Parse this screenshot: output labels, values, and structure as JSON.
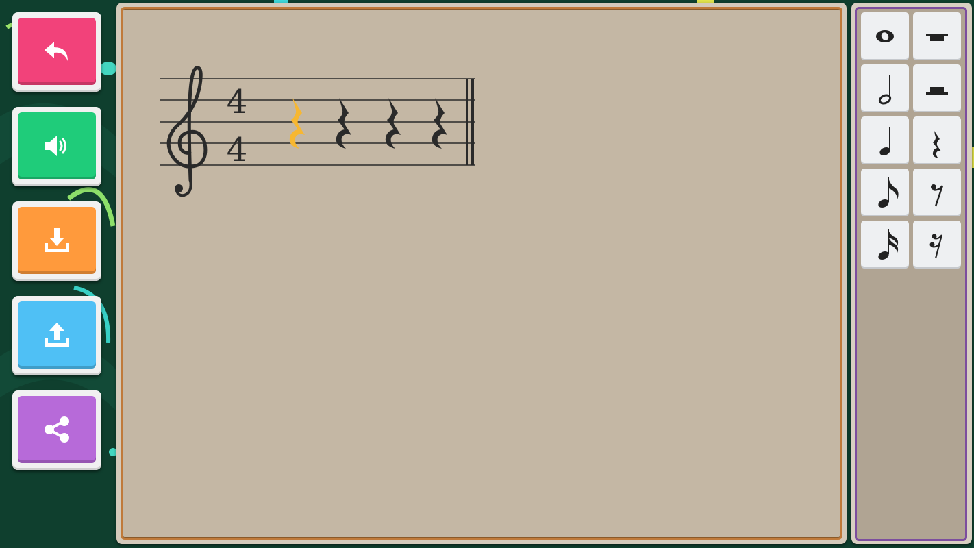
{
  "toolbar": {
    "buttons": [
      {
        "name": "undo-button",
        "icon": "undo-arrow-icon",
        "color": "#f2427a"
      },
      {
        "name": "play-sound-button",
        "icon": "speaker-icon",
        "color": "#1fcc7a"
      },
      {
        "name": "download-button",
        "icon": "download-icon",
        "color": "#ff9a3c"
      },
      {
        "name": "upload-button",
        "icon": "upload-icon",
        "color": "#4fc0f5"
      },
      {
        "name": "share-button",
        "icon": "share-icon",
        "color": "#b76ad9"
      }
    ]
  },
  "score": {
    "clef": "treble-clef",
    "time_signature": {
      "numerator": "4",
      "denominator": "4"
    },
    "measure": [
      {
        "symbol": "quarter-rest",
        "selected": true
      },
      {
        "symbol": "quarter-rest",
        "selected": false
      },
      {
        "symbol": "quarter-rest",
        "selected": false
      },
      {
        "symbol": "quarter-rest",
        "selected": false
      }
    ],
    "selected_color": "#f7b731",
    "ink_color": "#2a2a2a"
  },
  "palette": {
    "items": [
      {
        "name": "whole-note",
        "icon": "whole-note-icon"
      },
      {
        "name": "whole-rest",
        "icon": "whole-rest-icon"
      },
      {
        "name": "half-note",
        "icon": "half-note-icon"
      },
      {
        "name": "half-rest",
        "icon": "half-rest-icon"
      },
      {
        "name": "quarter-note",
        "icon": "quarter-note-icon"
      },
      {
        "name": "quarter-rest",
        "icon": "quarter-rest-icon"
      },
      {
        "name": "eighth-note",
        "icon": "eighth-note-icon"
      },
      {
        "name": "eighth-rest",
        "icon": "eighth-rest-icon"
      },
      {
        "name": "sixteenth-note",
        "icon": "sixteenth-note-icon"
      },
      {
        "name": "sixteenth-rest",
        "icon": "sixteenth-rest-icon"
      }
    ]
  },
  "colors": {
    "background": "#0f3f2e",
    "board": "#c4b7a4",
    "board_border": "#c07a3a",
    "palette_border": "#7c4d9e"
  }
}
